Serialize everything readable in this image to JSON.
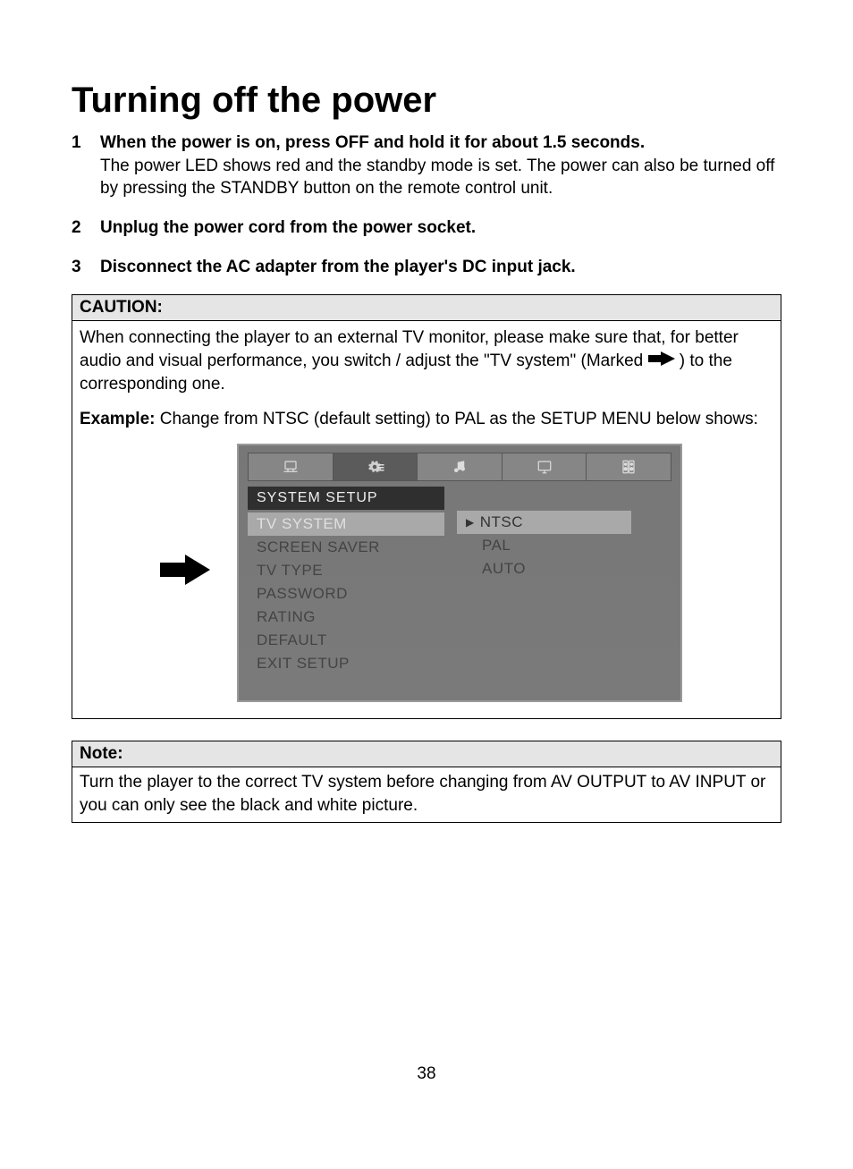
{
  "title": "Turning off the power",
  "steps": [
    {
      "num": "1",
      "head": "When the power is on, press OFF and hold it for about 1.5 seconds.",
      "body": "The power LED shows red and the standby mode is set. The power can also be turned off by pressing the STANDBY button on the remote control unit."
    },
    {
      "num": "2",
      "head": "Unplug the power cord from the power socket.",
      "body": ""
    },
    {
      "num": "3",
      "head": "Disconnect the AC adapter from the player's DC input jack.",
      "body": ""
    }
  ],
  "caution": {
    "label": "CAUTION:",
    "text_before": "When connecting the player to an external TV monitor, please make sure that, for better audio and visual performance, you switch / adjust the \"TV system\" (Marked ",
    "text_after": " ) to the corresponding one.",
    "example_label": "Example:",
    "example_text": " Change from NTSC (default setting) to PAL as the SETUP MENU below shows:"
  },
  "osd": {
    "section_title": "SYSTEM SETUP",
    "left_items": [
      {
        "label": "TV SYSTEM",
        "hl": true
      },
      {
        "label": "SCREEN SAVER",
        "hl": false
      },
      {
        "label": "TV TYPE",
        "hl": false
      },
      {
        "label": "PASSWORD",
        "hl": false
      },
      {
        "label": "RATING",
        "hl": false
      },
      {
        "label": "DEFAULT",
        "hl": false
      },
      {
        "label": "EXIT SETUP",
        "hl": false
      }
    ],
    "right_items": [
      {
        "label": "NTSC",
        "hl": true,
        "marker": true
      },
      {
        "label": "PAL",
        "hl": false,
        "marker": false
      },
      {
        "label": "AUTO",
        "hl": false,
        "marker": false
      }
    ]
  },
  "note": {
    "label": "Note:",
    "text": "Turn the player to the correct TV system before changing from AV OUTPUT to AV INPUT or you can only see the black and white picture."
  },
  "page_number": "38"
}
